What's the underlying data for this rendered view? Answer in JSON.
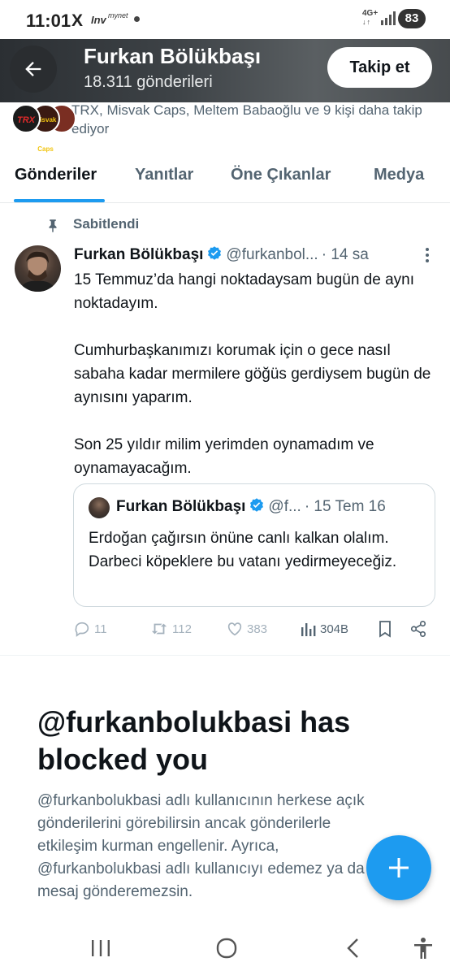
{
  "status_bar": {
    "time": "11:01",
    "app_icons": [
      "X",
      "Inv",
      "mynet"
    ],
    "network": "4G+",
    "battery": "83"
  },
  "header": {
    "name": "Furkan Bölükbaşı",
    "post_count": "18.311 gönderileri",
    "follow_label": "Takip et"
  },
  "followers": {
    "text": "TRX, Misvak Caps, Meltem Babaoğlu ve 9 kişi daha takip ediyor",
    "avatar_labels": [
      "TRX",
      "Misvak Caps"
    ]
  },
  "tabs": [
    {
      "label": "Gönderiler",
      "active": true
    },
    {
      "label": "Yanıtlar",
      "active": false
    },
    {
      "label": "Öne Çıkanlar",
      "active": false
    },
    {
      "label": "Medya",
      "active": false
    }
  ],
  "tweet": {
    "pinned_label": "Sabitlendi",
    "author": "Furkan Bölükbaşı",
    "handle": "@furkanbol...",
    "time": "· 14 sa",
    "paragraphs": [
      "15 Temmuz’da hangi noktadaysam bugün de aynı noktadayım.",
      "Cumhurbaşkanımızı korumak için o gece nasıl sabaha kadar mermilere göğüs gerdiysem bugün de aynısını yaparım.",
      "Son 25 yıldır milim yerimden oynamadım ve oynamayacağım."
    ],
    "quote": {
      "author": "Furkan Bölükbaşı",
      "handle": "@f...",
      "time": "· 15 Tem 16",
      "text": "Erdoğan çağırsın önüne canlı kalkan olalım. Darbeci köpeklere bu vatanı yedirmeyeceğiz."
    },
    "actions": {
      "replies": "11",
      "reposts": "112",
      "likes": "383",
      "views": "304B"
    }
  },
  "blocked": {
    "title": "@furkanbolukbasi has blocked you",
    "description": "@furkanbolukbasi adlı kullanıcının herkese açık gönderilerini görebilirsin ancak gönderilerle etkileşim kurman engellenir. Ayrıca, @furkanbolukbasi adlı kullanıcıyı edemez ya da ona mesaj gönderemezsin."
  },
  "colors": {
    "accent": "#1d9bf0",
    "text_primary": "#0f1419",
    "text_secondary": "#536471"
  }
}
